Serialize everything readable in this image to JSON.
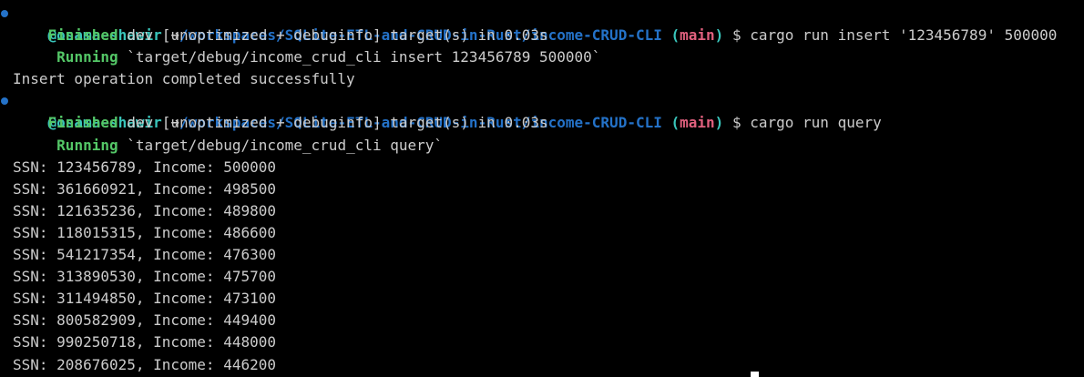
{
  "colors": {
    "background": "#000000",
    "text": "#cccccc",
    "user": "#39c5bb",
    "path": "#2472c8",
    "branch_paren": "#39c5bb",
    "branch": "#e0607e",
    "cargo_status": "#54c767",
    "prompt_dot": "#2472c8"
  },
  "icons": {
    "arrow": "arrow-right-icon",
    "prompt_dot": "prompt-dot-icon"
  },
  "prompt": {
    "user": "@osama-shawir",
    "arrow": "➜",
    "path": "/workspaces/SQLite-ETL-and-CRUD-in-Rust/income-CRUD-CLI",
    "branch_open": "(",
    "branch": "main",
    "branch_close": ")",
    "symbol": "$"
  },
  "session": [
    {
      "command": "cargo run insert '123456789' 500000",
      "finished_label": "Finished",
      "finished_text": "dev [unoptimized + debuginfo] target(s) in 0.03s",
      "running_label": "Running",
      "running_text": "`target/debug/income_crud_cli insert 123456789 500000`",
      "output": [
        "Insert operation completed successfully"
      ]
    },
    {
      "command": "cargo run query",
      "finished_label": "Finished",
      "finished_text": "dev [unoptimized + debuginfo] target(s) in 0.03s",
      "running_label": "Running",
      "running_text": "`target/debug/income_crud_cli query`",
      "output": [
        "SSN: 123456789, Income: 500000",
        "SSN: 361660921, Income: 498500",
        "SSN: 121635236, Income: 489800",
        "SSN: 118015315, Income: 486600",
        "SSN: 541217354, Income: 476300",
        "SSN: 313890530, Income: 475700",
        "SSN: 311494850, Income: 473100",
        "SSN: 800582909, Income: 449400",
        "SSN: 990250718, Income: 448000",
        "SSN: 208676025, Income: 446200"
      ]
    }
  ]
}
